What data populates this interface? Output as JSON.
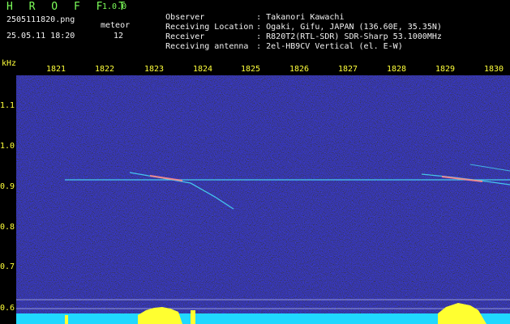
{
  "header": {
    "app_title": "H R O F F T",
    "version": "1.0.0",
    "file_name": "2505111820.png",
    "meteor_label": "meteor",
    "date_time": "25.05.11 18:20",
    "meteor_count": "12"
  },
  "info": [
    {
      "label": "Observer",
      "value": "Takanori Kawachi"
    },
    {
      "label": "Receiving Location",
      "value": "Ogaki, Gifu, JAPAN (136.60E, 35.35N)"
    },
    {
      "label": "Receiver",
      "value": "R820T2(RTL-SDR) SDR-Sharp 53.1000MHz"
    },
    {
      "label": "Receiving antenna",
      "value": "2el-HB9CV Vertical (el. E-W)"
    }
  ],
  "axis": {
    "y_unit": "kHz",
    "y_ticks": [
      "1.1",
      "1.0",
      "0.9",
      "0.8",
      "0.7",
      "0.6"
    ],
    "x_ticks": [
      "1821",
      "1822",
      "1823",
      "1824",
      "1825",
      "1826",
      "1827",
      "1828",
      "1829",
      "1830"
    ]
  },
  "colors": {
    "header_green": "#7dff5a",
    "axis_yellow": "#ffff3a",
    "info_white": "#f2f2f2",
    "background_noise": "#14148c",
    "signal_cyan": "#48e8ff"
  }
}
